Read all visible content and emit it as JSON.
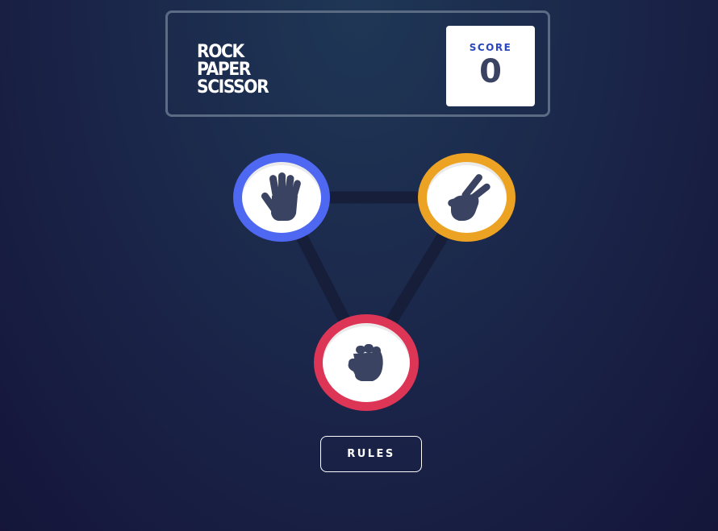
{
  "header": {
    "title_lines": [
      "ROCK",
      "PAPER",
      "SCISSOR"
    ],
    "score_label": "SCORE",
    "score_value": "0"
  },
  "choices": [
    {
      "id": "paper",
      "icon": "paper-hand-icon",
      "ring_color": "#4e68f1"
    },
    {
      "id": "scissors",
      "icon": "scissors-hand-icon",
      "ring_color": "#eca222"
    },
    {
      "id": "rock",
      "icon": "rock-fist-icon",
      "ring_color": "#dc3556"
    }
  ],
  "rules_button": {
    "label": "RULES"
  },
  "colors": {
    "background_top": "#1f3756",
    "background_bottom": "#141539",
    "header_outline": "#5b6b84",
    "score_label": "#2a46c0",
    "score_value": "#3b4363",
    "icon": "#3b4363"
  }
}
